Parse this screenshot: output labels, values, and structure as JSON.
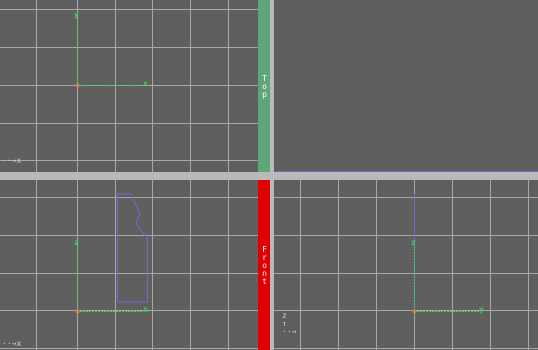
{
  "viewports": {
    "top": {
      "tab_label": "Top",
      "tab_color": "#5fa778",
      "axis_x": "x",
      "axis_y": "y",
      "tripod": "x"
    },
    "front": {
      "tab_label": "Front",
      "tab_color": "#e00000",
      "axis_x": "x",
      "axis_z": "z",
      "tripod": "x"
    },
    "side": {
      "axis_z": "z",
      "axis_y": "y",
      "tripod": "z"
    },
    "perspective": {}
  },
  "colors": {
    "background": "#5f5f5f",
    "grid": "#a8a8a8",
    "axis": "#3fd35a",
    "divider": "#b9b9b9",
    "outline": "#6c6ccd"
  }
}
